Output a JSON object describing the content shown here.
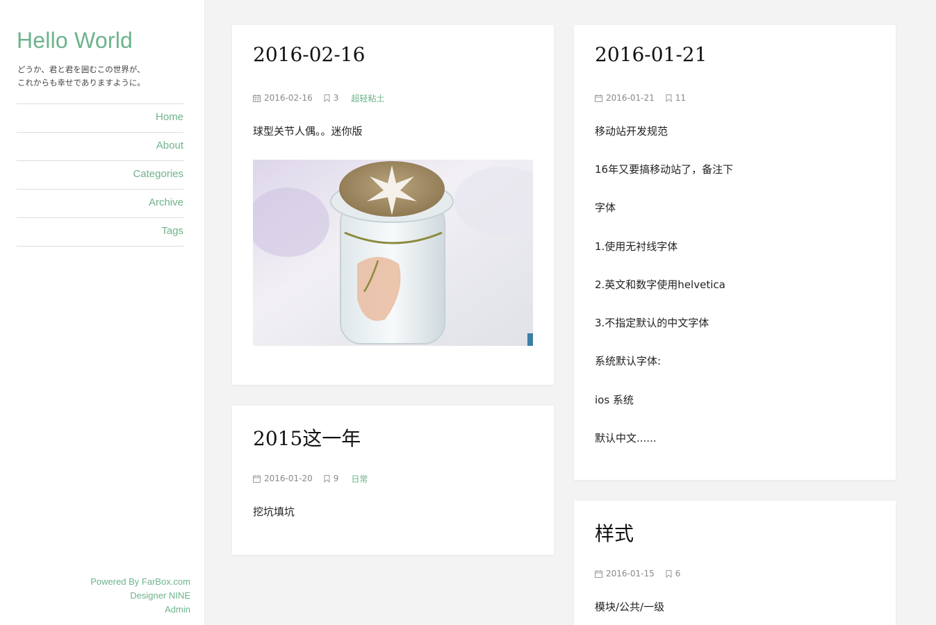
{
  "site": {
    "title": "Hello World",
    "tagline_line1": "どうか、君と君を囲むこの世界が、",
    "tagline_line2": "これからも幸せでありますように。",
    "accent": "#6db38b"
  },
  "nav": {
    "items": [
      {
        "label": "Home"
      },
      {
        "label": "About"
      },
      {
        "label": "Categories"
      },
      {
        "label": "Archive"
      },
      {
        "label": "Tags"
      }
    ]
  },
  "footer": {
    "powered": "Powered By FarBox.com",
    "designer": "Designer NINE",
    "admin": "Admin"
  },
  "posts": [
    {
      "title": "2016-02-16",
      "date": "2016-02-16",
      "comments": "3",
      "category": "超轻粘土",
      "excerpt": [
        "球型关节人偶。。迷你版"
      ],
      "image": "glass-jar-photo"
    },
    {
      "title": "2015这一年",
      "date": "2016-01-20",
      "comments": "9",
      "category": "日常",
      "excerpt": [
        "挖坑填坑"
      ]
    },
    {
      "title": "2016-01-21",
      "date": "2016-01-21",
      "comments": "11",
      "excerpt": [
        "移动站开发规范",
        "16年又要搞移动站了，备注下",
        "字体",
        "1.使用无衬线字体",
        "2.英文和数字使用helvetica",
        "3.不指定默认的中文字体",
        "系统默认字体:",
        "ios 系统",
        "默认中文......"
      ]
    },
    {
      "title": "样式",
      "date": "2016-01-15",
      "comments": "6",
      "excerpt": [
        "模块/公共/一级"
      ]
    }
  ]
}
